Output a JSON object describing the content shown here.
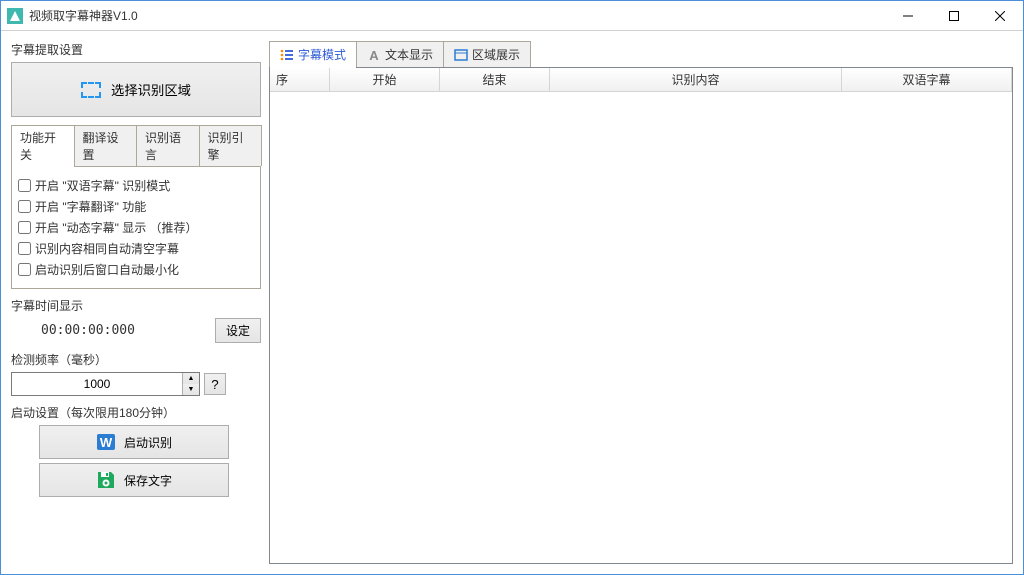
{
  "window": {
    "title": "视频取字幕神器V1.0"
  },
  "left": {
    "extract_label": "字幕提取设置",
    "select_region_button": "选择识别区域",
    "sub_tabs": [
      "功能开关",
      "翻译设置",
      "识别语言",
      "识别引擎"
    ],
    "checkboxes": [
      "开启 \"双语字幕\" 识别模式",
      "开启 \"字幕翻译\" 功能",
      "开启 \"动态字幕\" 显示  （推荐）",
      "识别内容相同自动清空字幕",
      "启动识别后窗口自动最小化"
    ],
    "time_section_label": "字幕时间显示",
    "time_value": "00:00:00:000",
    "time_set_button": "设定",
    "freq_label": "检测频率（毫秒）",
    "freq_value": "1000",
    "help_button": "?",
    "start_section_label": "启动设置（每次限用180分钟）",
    "start_button": "启动识别",
    "save_button": "保存文字"
  },
  "main_tabs": [
    "字幕模式",
    "文本显示",
    "区域展示"
  ],
  "table": {
    "headers": [
      "序",
      "开始",
      "结束",
      "识别内容",
      "双语字幕"
    ]
  }
}
